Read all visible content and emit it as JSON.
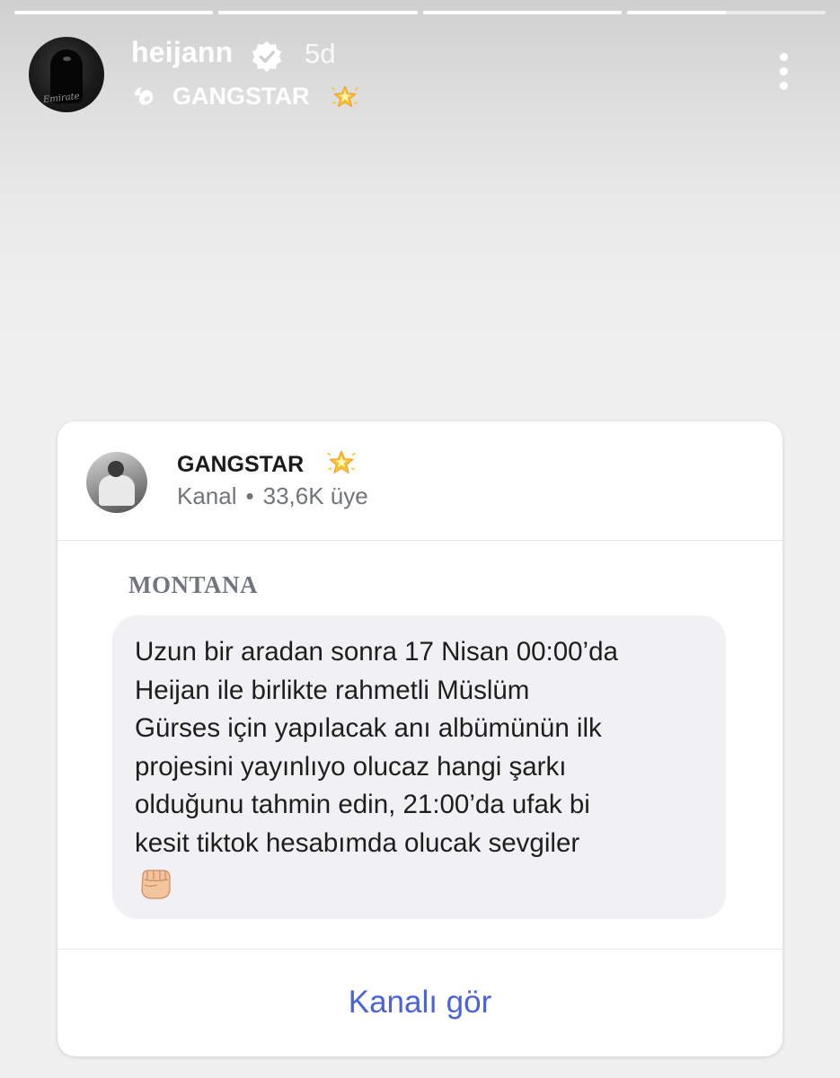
{
  "story": {
    "segments": [
      {
        "progress": 1.0
      },
      {
        "progress": 1.0
      },
      {
        "progress": 1.0
      },
      {
        "progress": 0.5
      }
    ],
    "username": "heijann",
    "verified_icon": "verified-badge-icon",
    "time_ago": "5d",
    "channel_label": "GANGSTAR",
    "channel_icon": "channel-share-icon",
    "more_icon": "more-vertical-icon"
  },
  "card": {
    "channel_name": "GANGSTAR",
    "channel_type": "Kanal",
    "separator": "•",
    "members": "33,6K üye",
    "sender": "MONTANA",
    "message": "Uzun bir aradan sonra 17 Nisan 00:00’da\nHeijan ile birlikte rahmetli Müslüm\nGürses için yapılacak anı albümünün ilk\nprojesini yayınlıyo olucaz hangi şarkı\nolduğunu tahmin edin, 21:00’da ufak bi\nkesit tiktok hesabımda olucak sevgiler",
    "emoji_icon": "fist-emoji-icon",
    "view_channel_label": "Kanalı gör"
  },
  "colors": {
    "accent": "#4a63d8",
    "bubble": "#f1f1f4",
    "secondary_text": "#707579"
  }
}
